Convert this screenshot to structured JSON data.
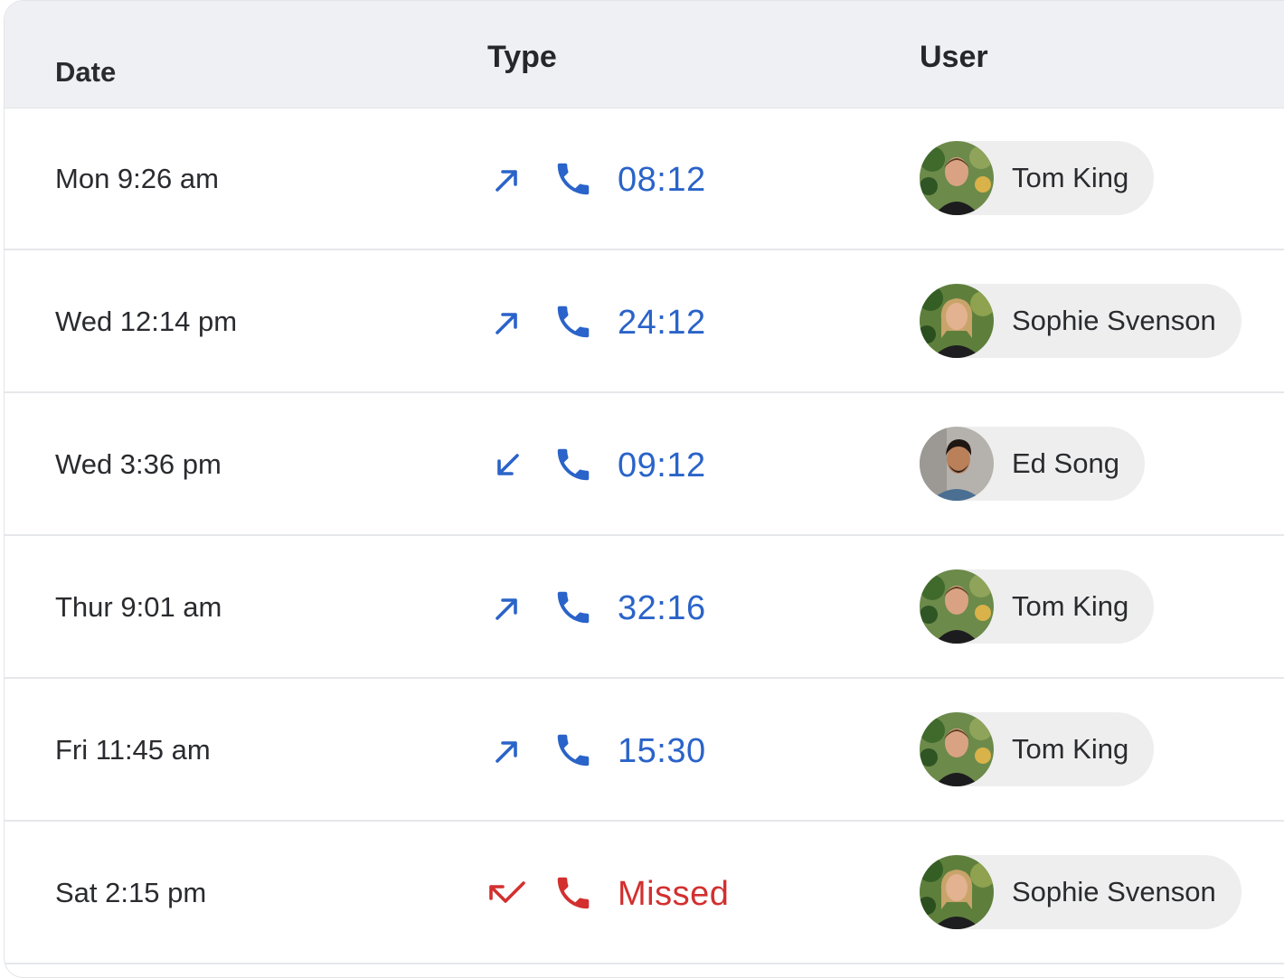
{
  "header": {
    "date_label": "Date",
    "type_label": "Type",
    "user_label": "User"
  },
  "colors": {
    "outgoing": "#2a63c9",
    "missed": "#d32f2f"
  },
  "rows": [
    {
      "date": "Mon 9:26 am",
      "direction": "outgoing-arrow-icon",
      "duration": "08:12",
      "status": "normal",
      "user": "Tom King"
    },
    {
      "date": "Wed 12:14 pm",
      "direction": "outgoing-arrow-icon",
      "duration": "24:12",
      "status": "normal",
      "user": "Sophie Svenson"
    },
    {
      "date": "Wed 3:36 pm",
      "direction": "incoming-arrow-icon",
      "duration": "09:12",
      "status": "normal",
      "user": "Ed Song"
    },
    {
      "date": "Thur 9:01 am",
      "direction": "outgoing-arrow-icon",
      "duration": "32:16",
      "status": "normal",
      "user": "Tom King"
    },
    {
      "date": "Fri 11:45 am",
      "direction": "outgoing-arrow-icon",
      "duration": "15:30",
      "status": "normal",
      "user": "Tom King"
    },
    {
      "date": "Sat 2:15 pm",
      "direction": "missed-arrow-icon",
      "duration": "Missed",
      "status": "missed",
      "user": "Sophie Svenson"
    }
  ]
}
